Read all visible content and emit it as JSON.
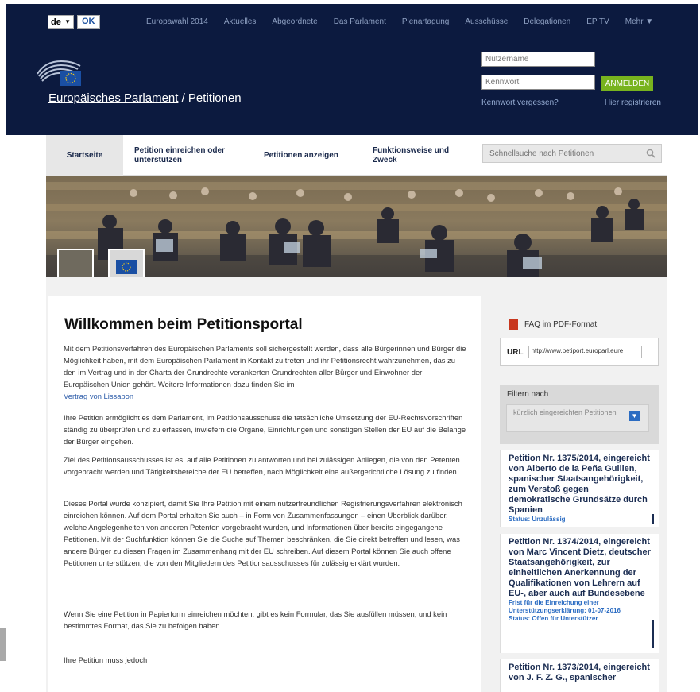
{
  "header": {
    "lang_value": "de",
    "lang_ok": "OK",
    "topnav": [
      "Europawahl 2014",
      "Aktuelles",
      "Abgeordnete",
      "Das Parlament",
      "Plenartagung",
      "Ausschüsse",
      "Delegationen",
      "EP TV",
      "Mehr ▼"
    ],
    "site_title_main": "Europäisches Parlament",
    "site_title_sep": " / Petitionen",
    "username_placeholder": "Nutzername",
    "password_placeholder": "Kennwort",
    "login_button": "ANMELDEN",
    "forgot_password": "Kennwort vergessen?",
    "register": "Hier registrieren"
  },
  "subnav": {
    "items": [
      "Startseite",
      "Petition einreichen oder unterstützen",
      "Petitionen anzeigen",
      "Funktionsweise und Zweck"
    ],
    "search_placeholder": "Schnellsuche nach Petitionen"
  },
  "main": {
    "title": "Willkommen beim Petitionsportal",
    "p1": "Mit dem Petitionsverfahren des Europäischen Parlaments soll sichergestellt werden, dass alle Bürgerinnen und Bürger die Möglichkeit haben, mit dem Europäischen Parlament in Kontakt zu treten und ihr Petitionsrecht wahrzunehmen, das zu den im Vertrag und in der Charta der Grundrechte verankerten Grundrechten aller Bürger und Einwohner der Europäischen Union gehört. Weitere Informationen dazu finden Sie im",
    "p1_link": "Vertrag von Lissabon",
    "p2": "Ihre Petition ermöglicht es dem Parlament, im Petitionsausschuss die tatsächliche Umsetzung der EU-Rechtsvorschriften ständig zu überprüfen und zu erfassen, inwiefern die Organe, Einrichtungen und sonstigen Stellen der EU auf die Belange der Bürger eingehen.",
    "p3": "Ziel des Petitionsausschusses ist es, auf alle Petitionen zu antworten und bei zulässigen Anliegen, die von den Petenten vorgebracht werden und Tätigkeitsbereiche der EU betreffen, nach Möglichkeit eine außergerichtliche Lösung zu finden.",
    "p4": "Dieses Portal wurde konzipiert, damit Sie Ihre Petition mit einem nutzerfreundlichen Registrierungsverfahren elektronisch einreichen können. Auf dem Portal erhalten Sie auch – in Form von Zusammenfassungen – einen Überblick darüber, welche Angelegenheiten von anderen Petenten vorgebracht wurden, und Informationen über bereits eingegangene Petitionen. Mit der Suchfunktion können Sie die Suche auf Themen beschränken, die Sie direkt betreffen und lesen, was andere Bürger zu diesen Fragen im Zusammenhang mit der EU schreiben. Auf diesem Portal können Sie auch offene Petitionen unterstützen, die von den Mitgliedern des Petitionsausschusses für zulässig erklärt wurden.",
    "p5": "Wenn Sie eine Petition in Papierform einreichen möchten, gibt es kein Formular, das Sie ausfüllen müssen, und kein bestimmtes Format, das Sie zu befolgen haben.",
    "p6": "Ihre Petition muss jedoch"
  },
  "sidebar": {
    "faq": "FAQ im PDF-Format",
    "url_label": "URL",
    "url_value": "http://www.petiport.europarl.eure",
    "filter_label": "Filtern nach",
    "filter_value": "kürzlich eingereichten Petitionen",
    "petitions": [
      {
        "title": "Petition Nr. 1375/2014, eingereicht von Alberto de la Peña Guillen, spanischer Staatsangehörigkeit, zum Verstoß gegen demokratische Grundsätze durch Spanien",
        "status": "Status: Unzulässig"
      },
      {
        "title": "Petition Nr. 1374/2014, eingereicht von Marc Vincent Dietz, deutscher Staatsangehörigkeit, zur einheitlichen Anerkennung der Qualifikationen von Lehrern auf EU-, aber auch auf Bundesebene",
        "deadline": "Frist für die Einreichung einer Unterstützungserklärung: 01-07-2016",
        "status": "Status: Offen für Unterstützer"
      },
      {
        "title": "Petition Nr. 1373/2014, eingereicht von J. F. Z. G., spanischer",
        "status": ""
      }
    ]
  }
}
